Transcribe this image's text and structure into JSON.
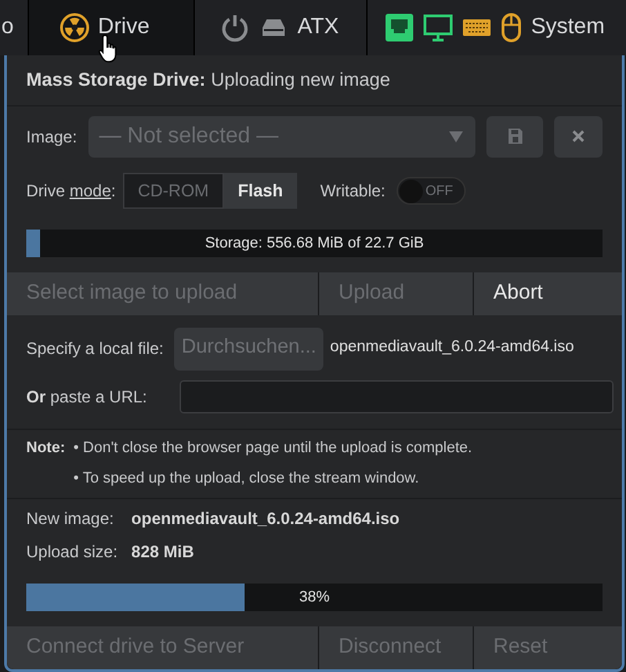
{
  "menu": [
    {
      "label": "o",
      "selected": false
    },
    {
      "label": "Drive",
      "selected": true
    },
    {
      "label": "ATX",
      "selected": false,
      "indicators": [
        {
          "kind": "power",
          "color": "#8a8c8f"
        },
        {
          "kind": "hdd",
          "color": "#8a8c8f"
        }
      ]
    },
    {
      "label": "System",
      "selected": false,
      "indicators": [
        {
          "kind": "ethernet",
          "color": "#2ecc71"
        },
        {
          "kind": "monitor",
          "color": "#2ecc71"
        },
        {
          "kind": "keyboard",
          "color": "#e0a12a"
        },
        {
          "kind": "mouse",
          "color": "#e0a12a"
        }
      ]
    }
  ],
  "panel": {
    "title_bold": "Mass Storage Drive:",
    "title": "Uploading new image",
    "image": {
      "label": "Image:",
      "placeholder": "— Not selected —"
    },
    "mode": {
      "label": "Drive ",
      "label_link": "mode",
      "label_end": ":",
      "options": [
        {
          "label": "CD-ROM",
          "selected": false
        },
        {
          "label": "Flash",
          "selected": true
        }
      ]
    },
    "writable": {
      "label": "Writable:",
      "on": false,
      "reading": "OFF"
    },
    "storage": {
      "level": 0.024,
      "reading": "Storage: 556.68 MiB of 22.7 GiB"
    },
    "actions": [
      {
        "label": "Select image to upload",
        "disabled": true
      },
      {
        "label": "Upload",
        "disabled": true
      },
      {
        "label": "Abort",
        "disabled": false
      }
    ],
    "local_file": {
      "label": "Specify a local file:",
      "button": "Durchsuchen...",
      "file": "openmediavault_6.0.24-amd64.iso"
    },
    "url": {
      "label_bold": "Or",
      "label": " paste a URL:"
    },
    "note": {
      "label": "Note:",
      "lines": [
        "• Don't close the browser page until the upload is complete.",
        "• To speed up the upload, close the stream window."
      ]
    },
    "info": [
      {
        "label": "New image:",
        "value": "openmediavault_6.0.24-amd64.iso"
      },
      {
        "label": "Upload size:",
        "value": "828 MiB"
      }
    ],
    "upload": {
      "level": 0.38,
      "reading": "38%"
    },
    "bottom": [
      {
        "label": "Connect drive to Server",
        "disabled": true
      },
      {
        "label": "Disconnect",
        "disabled": true
      },
      {
        "label": "Reset",
        "disabled": true
      }
    ]
  }
}
